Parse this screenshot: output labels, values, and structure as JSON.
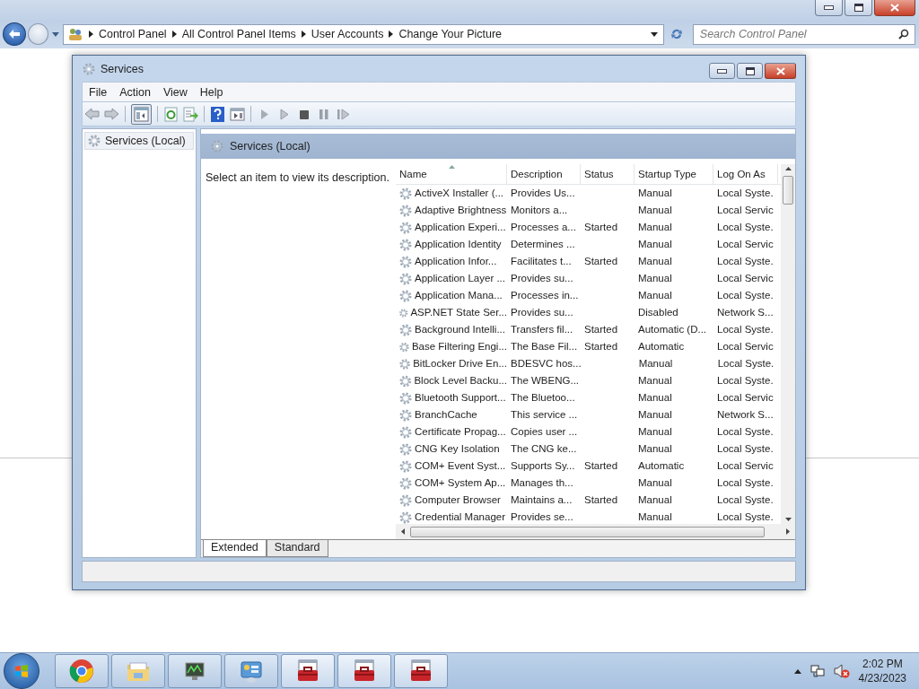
{
  "explorer": {
    "breadcrumb": [
      "Control Panel",
      "All Control Panel Items",
      "User Accounts",
      "Change Your Picture"
    ],
    "search": {
      "placeholder": "Search Control Panel"
    }
  },
  "window": {
    "title": "Services",
    "menu": [
      "File",
      "Action",
      "View",
      "Help"
    ],
    "tree": [
      {
        "label": "Services (Local)",
        "selected": true
      }
    ],
    "pane_title": "Services (Local)",
    "description_hint": "Select an item to view its description.",
    "table": {
      "columns": [
        {
          "label": "Name",
          "sorted": true
        },
        {
          "label": "Description",
          "sorted": false
        },
        {
          "label": "Status",
          "sorted": false
        },
        {
          "label": "Startup Type",
          "sorted": false
        },
        {
          "label": "Log On As",
          "sorted": false
        }
      ],
      "rows": [
        {
          "name": "ActiveX Installer (...",
          "description": "Provides Us...",
          "startup_type": "Manual",
          "log_on_as": "Local Syste."
        },
        {
          "name": "Adaptive Brightness",
          "description": "Monitors a...",
          "startup_type": "Manual",
          "log_on_as": "Local Servic"
        },
        {
          "name": "Application Experi...",
          "description": "Processes a...",
          "status": "Started",
          "startup_type": "Manual",
          "log_on_as": "Local Syste."
        },
        {
          "name": "Application Identity",
          "description": "Determines ...",
          "startup_type": "Manual",
          "log_on_as": "Local Servic"
        },
        {
          "name": "Application Infor...",
          "description": "Facilitates t...",
          "status": "Started",
          "startup_type": "Manual",
          "log_on_as": "Local Syste."
        },
        {
          "name": "Application Layer ...",
          "description": "Provides su...",
          "startup_type": "Manual",
          "log_on_as": "Local Servic"
        },
        {
          "name": "Application Mana...",
          "description": "Processes in...",
          "startup_type": "Manual",
          "log_on_as": "Local Syste."
        },
        {
          "name": "ASP.NET State Ser...",
          "description": "Provides su...",
          "startup_type": "Disabled",
          "log_on_as": "Network S..."
        },
        {
          "name": "Background Intelli...",
          "description": "Transfers fil...",
          "status": "Started",
          "startup_type": "Automatic (D...",
          "log_on_as": "Local Syste."
        },
        {
          "name": "Base Filtering Engi...",
          "description": "The Base Fil...",
          "status": "Started",
          "startup_type": "Automatic",
          "log_on_as": "Local Servic"
        },
        {
          "name": "BitLocker Drive En...",
          "description": "BDESVC hos...",
          "startup_type": "Manual",
          "log_on_as": "Local Syste."
        },
        {
          "name": "Block Level Backu...",
          "description": "The WBENG...",
          "startup_type": "Manual",
          "log_on_as": "Local Syste."
        },
        {
          "name": "Bluetooth Support...",
          "description": "The Bluetoo...",
          "startup_type": "Manual",
          "log_on_as": "Local Servic"
        },
        {
          "name": "BranchCache",
          "description": "This service ...",
          "startup_type": "Manual",
          "log_on_as": "Network S..."
        },
        {
          "name": "Certificate Propag...",
          "description": "Copies user ...",
          "startup_type": "Manual",
          "log_on_as": "Local Syste."
        },
        {
          "name": "CNG Key Isolation",
          "description": "The CNG ke...",
          "startup_type": "Manual",
          "log_on_as": "Local Syste."
        },
        {
          "name": "COM+ Event Syst...",
          "description": "Supports Sy...",
          "status": "Started",
          "startup_type": "Automatic",
          "log_on_as": "Local Servic"
        },
        {
          "name": "COM+ System Ap...",
          "description": "Manages th...",
          "startup_type": "Manual",
          "log_on_as": "Local Syste."
        },
        {
          "name": "Computer Browser",
          "description": "Maintains a...",
          "status": "Started",
          "startup_type": "Manual",
          "log_on_as": "Local Syste."
        },
        {
          "name": "Credential Manager",
          "description": "Provides se...",
          "startup_type": "Manual",
          "log_on_as": "Local Syste."
        }
      ]
    },
    "tabs": [
      {
        "label": "Extended",
        "selected": true
      },
      {
        "label": "Standard",
        "selected": false
      }
    ]
  },
  "taskbar": {
    "buttons": [
      {
        "kind": "browser"
      },
      {
        "kind": "folder"
      },
      {
        "kind": "monitor"
      },
      {
        "kind": "panel"
      },
      {
        "kind": "toolbox"
      },
      {
        "kind": "toolbox"
      },
      {
        "kind": "toolbox"
      }
    ],
    "time": "2:02 PM",
    "date": "4/23/2023"
  }
}
